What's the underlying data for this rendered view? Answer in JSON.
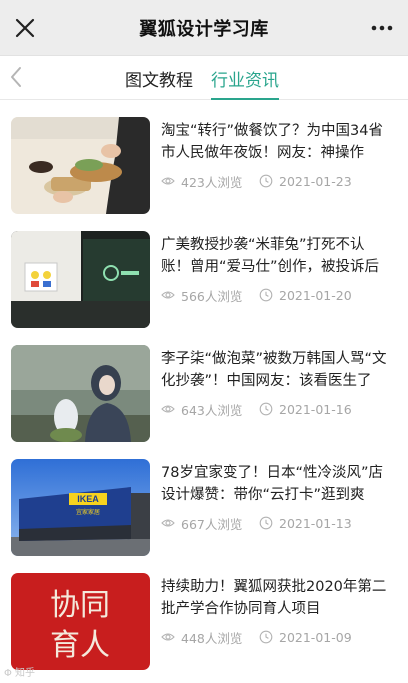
{
  "header": {
    "title": "翼狐设计学习库",
    "close_icon": "close-icon",
    "more_icon": "more-icon"
  },
  "tabs": [
    {
      "label": "图文教程",
      "active": false
    },
    {
      "label": "行业资讯",
      "active": true
    }
  ],
  "accent_color": "#2aa58d",
  "articles": [
    {
      "title": "淘宝“转行”做餐饮了？为中国34省市人民做年夜饭！网友：神操作",
      "views": "423人浏览",
      "date": "2021-01-23",
      "thumb": "food-image"
    },
    {
      "title": "广美教授抄袭“米菲兔”打死不认账！曾用“爱马仕”创作，被投诉后改名",
      "views": "566人浏览",
      "date": "2021-01-20",
      "thumb": "gallery-image"
    },
    {
      "title": "李子柒“做泡菜”被数万韩国人骂“文化抄袭”！中国网友：该看医生了",
      "views": "643人浏览",
      "date": "2021-01-16",
      "thumb": "person-image"
    },
    {
      "title": "78岁宜家变了！日本“性冷淡风”店设计爆赞：带你“云打卡”逛到爽",
      "views": "667人浏览",
      "date": "2021-01-13",
      "thumb": "ikea-store-image",
      "thumb_text": [
        "IKEA",
        "宜家家居"
      ]
    },
    {
      "title": "持续助力！翼狐网获批2020年第二批产学合作协同育人项目",
      "views": "448人浏览",
      "date": "2021-01-09",
      "thumb": "calligraphy-image",
      "thumb_text": [
        "协同",
        "育人"
      ]
    }
  ],
  "watermark": "Φ 知乎"
}
